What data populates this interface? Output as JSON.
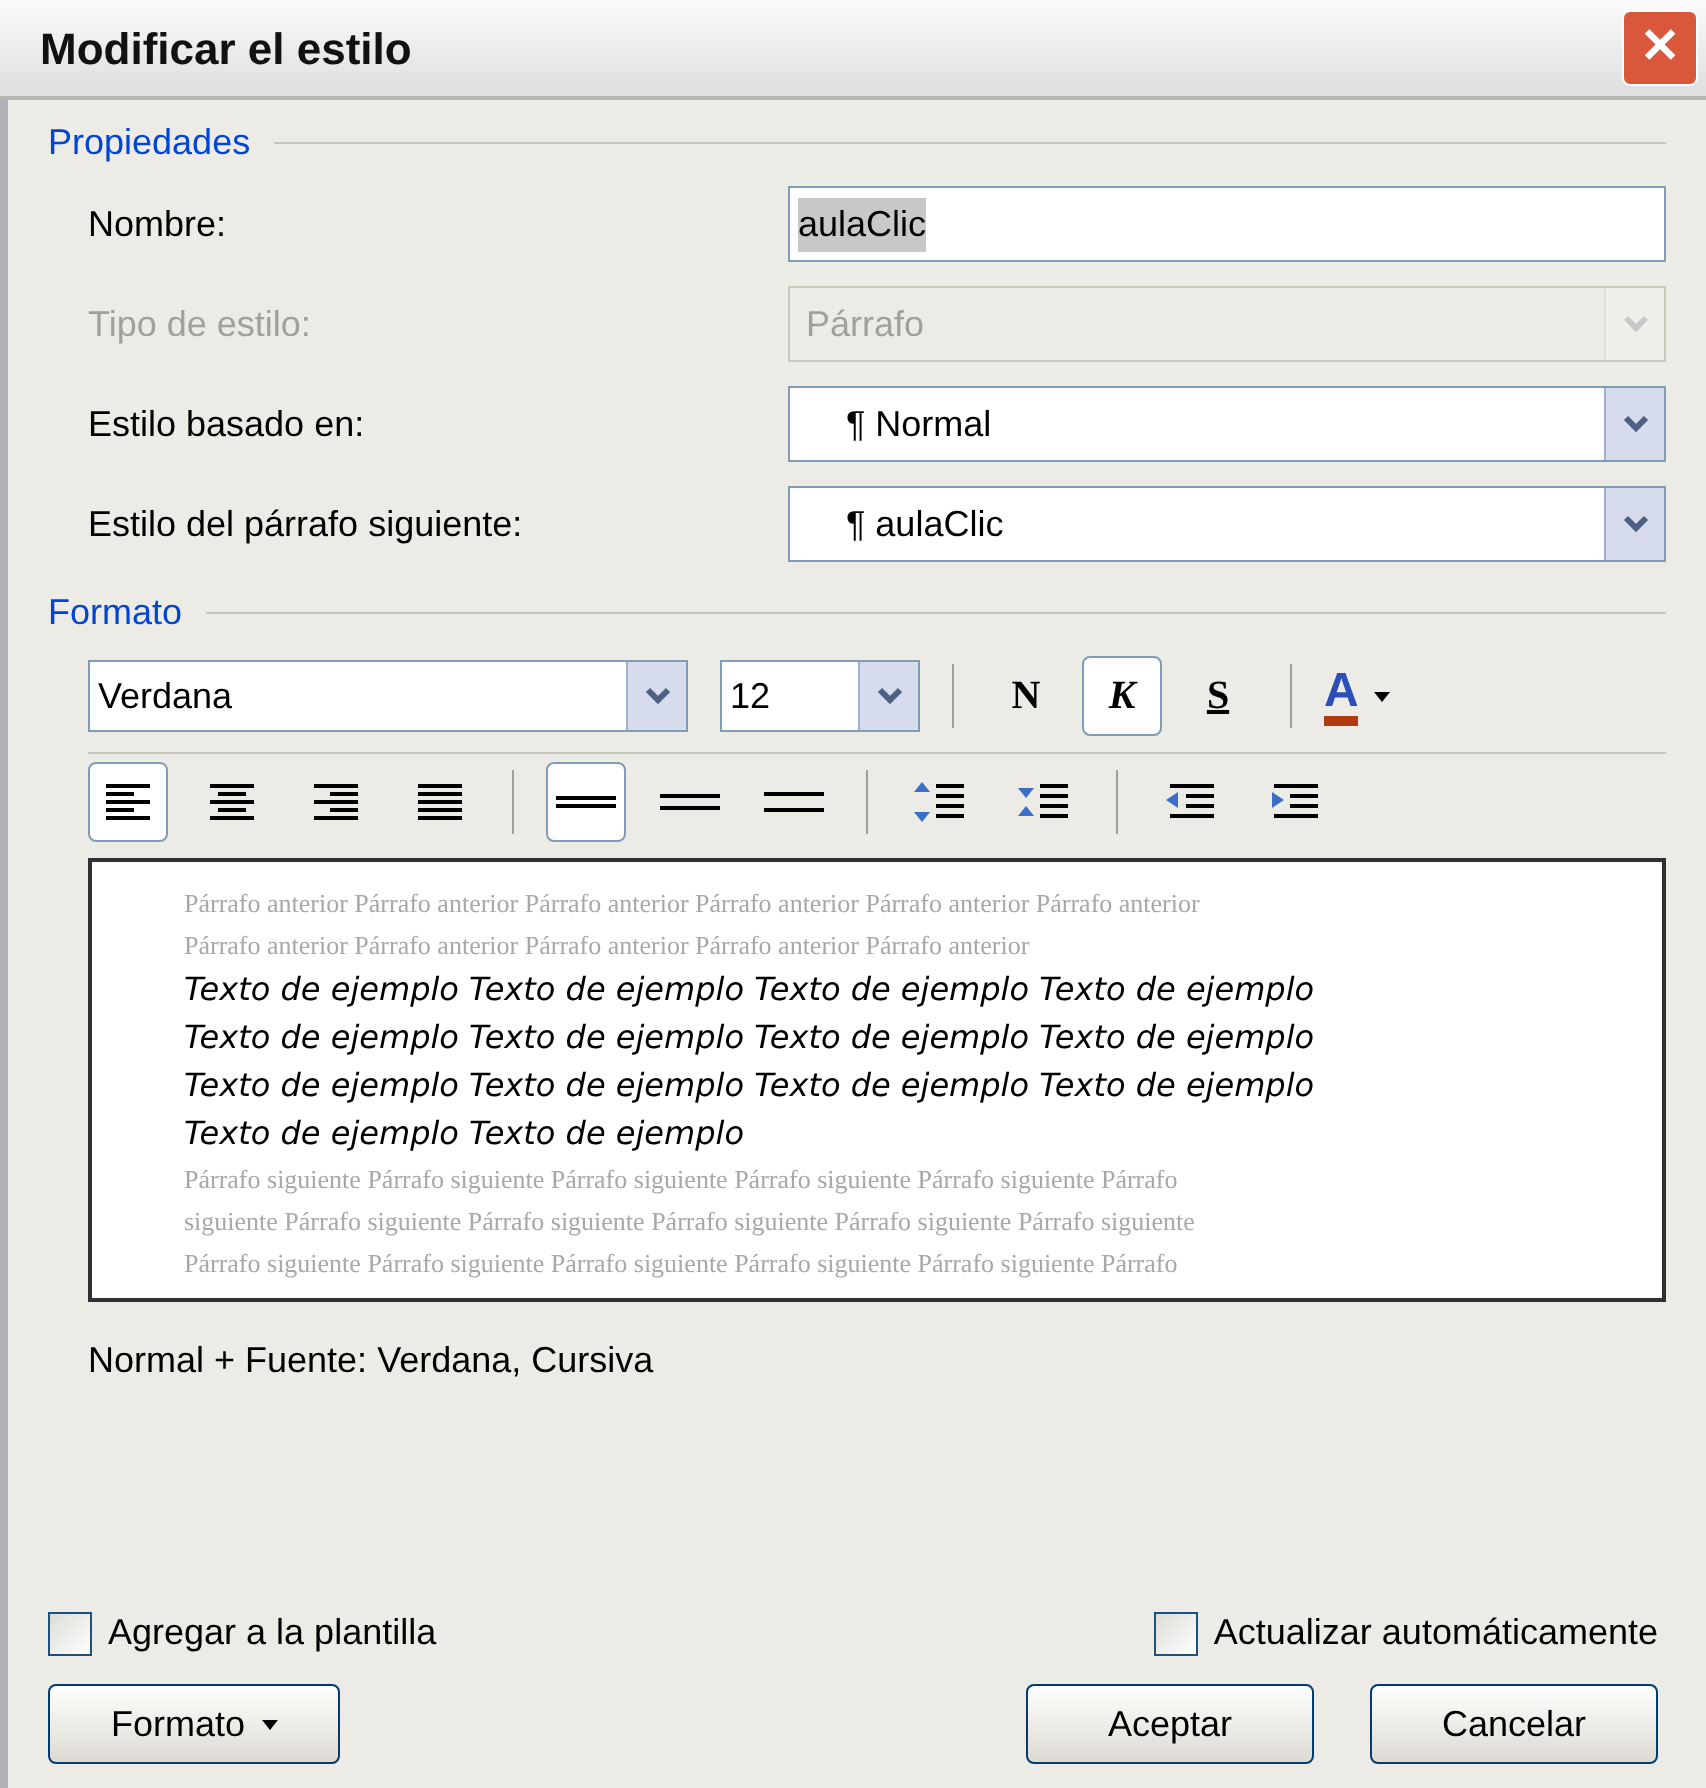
{
  "window": {
    "title": "Modificar el estilo",
    "close_label": "✕"
  },
  "properties": {
    "legend": "Propiedades",
    "fields": [
      {
        "label": "Nombre:",
        "kind": "text",
        "value": "aulaClic",
        "disabled": false
      },
      {
        "label": "Tipo de estilo:",
        "kind": "select",
        "value": "Párrafo",
        "disabled": true
      },
      {
        "label": "Estilo basado en:",
        "kind": "select",
        "value": "¶ Normal",
        "disabled": false
      },
      {
        "label": "Estilo del párrafo siguiente:",
        "kind": "select",
        "value": "¶ aulaClic",
        "disabled": false
      }
    ]
  },
  "format": {
    "legend": "Formato",
    "font": "Verdana",
    "size": "12",
    "styles": [
      {
        "label": "N",
        "kind": "bold",
        "selected": false
      },
      {
        "label": "K",
        "kind": "italic",
        "selected": true
      },
      {
        "label": "S",
        "kind": "underline",
        "selected": false
      }
    ],
    "color_button": "A",
    "align": [
      {
        "kind": "left",
        "selected": true
      },
      {
        "kind": "center",
        "selected": false
      },
      {
        "kind": "right",
        "selected": false
      },
      {
        "kind": "justify",
        "selected": false
      }
    ],
    "spacing": [
      {
        "kind": "single",
        "selected": true
      },
      {
        "kind": "one-half",
        "selected": false
      },
      {
        "kind": "double",
        "selected": false
      }
    ],
    "paragraph": [
      {
        "kind": "space-before"
      },
      {
        "kind": "space-after"
      },
      {
        "kind": "outdent"
      },
      {
        "kind": "indent"
      }
    ]
  },
  "preview": {
    "lines": [
      {
        "kind": "previous",
        "text": "Párrafo anterior Párrafo anterior Párrafo anterior Párrafo anterior Párrafo anterior Párrafo anterior"
      },
      {
        "kind": "previous",
        "text": "Párrafo anterior Párrafo anterior Párrafo anterior Párrafo anterior Párrafo anterior"
      },
      {
        "kind": "sample",
        "text": "Texto de ejemplo Texto de ejemplo Texto de ejemplo Texto de ejemplo"
      },
      {
        "kind": "sample",
        "text": "Texto de ejemplo Texto de ejemplo Texto de ejemplo Texto de ejemplo"
      },
      {
        "kind": "sample",
        "text": "Texto de ejemplo Texto de ejemplo Texto de ejemplo Texto de ejemplo"
      },
      {
        "kind": "sample",
        "text": "Texto de ejemplo Texto de ejemplo"
      },
      {
        "kind": "next",
        "text": "Párrafo siguiente Párrafo siguiente Párrafo siguiente Párrafo siguiente Párrafo siguiente Párrafo"
      },
      {
        "kind": "next",
        "text": "siguiente Párrafo siguiente Párrafo siguiente Párrafo siguiente Párrafo siguiente Párrafo siguiente"
      },
      {
        "kind": "next",
        "text": "Párrafo siguiente Párrafo siguiente Párrafo siguiente Párrafo siguiente Párrafo siguiente Párrafo"
      }
    ]
  },
  "description": "Normal + Fuente: Verdana, Cursiva",
  "options": [
    {
      "label": "Agregar a la plantilla",
      "checked": false
    },
    {
      "label": "Actualizar automáticamente",
      "checked": false
    }
  ],
  "buttons": {
    "format": "Formato",
    "ok": "Aceptar",
    "cancel": "Cancelar"
  }
}
